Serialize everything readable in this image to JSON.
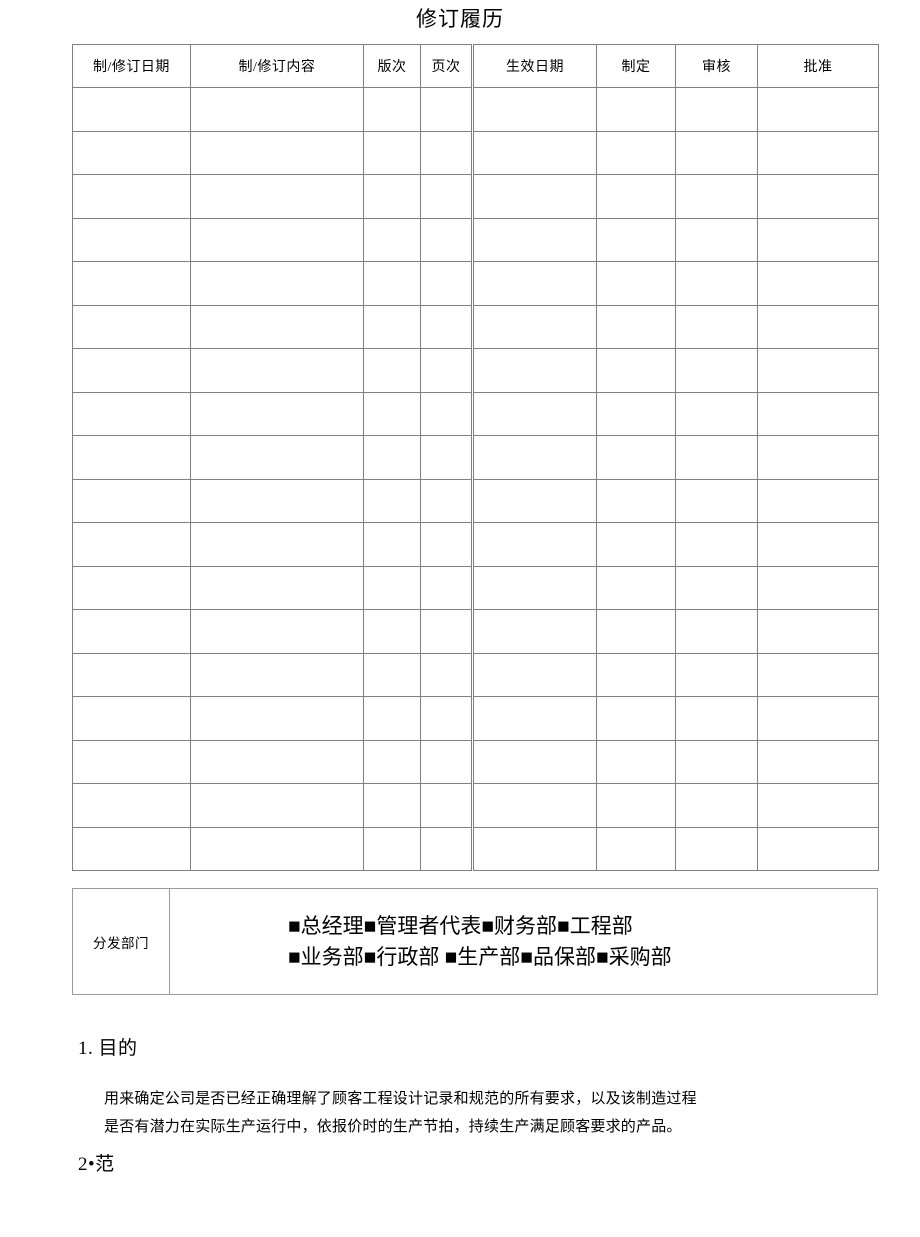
{
  "document": {
    "title": "修订履历"
  },
  "revision_table": {
    "headers": [
      "制/修订日期",
      "制/修订内容",
      "版次",
      "页次",
      "生效日期",
      "制定",
      "审核",
      "批准"
    ],
    "row_count": 18,
    "rows": [
      [
        "",
        "",
        "",
        "",
        "",
        "",
        "",
        ""
      ],
      [
        "",
        "",
        "",
        "",
        "",
        "",
        "",
        ""
      ],
      [
        "",
        "",
        "",
        "",
        "",
        "",
        "",
        ""
      ],
      [
        "",
        "",
        "",
        "",
        "",
        "",
        "",
        ""
      ],
      [
        "",
        "",
        "",
        "",
        "",
        "",
        "",
        ""
      ],
      [
        "",
        "",
        "",
        "",
        "",
        "",
        "",
        ""
      ],
      [
        "",
        "",
        "",
        "",
        "",
        "",
        "",
        ""
      ],
      [
        "",
        "",
        "",
        "",
        "",
        "",
        "",
        ""
      ],
      [
        "",
        "",
        "",
        "",
        "",
        "",
        "",
        ""
      ],
      [
        "",
        "",
        "",
        "",
        "",
        "",
        "",
        ""
      ],
      [
        "",
        "",
        "",
        "",
        "",
        "",
        "",
        ""
      ],
      [
        "",
        "",
        "",
        "",
        "",
        "",
        "",
        ""
      ],
      [
        "",
        "",
        "",
        "",
        "",
        "",
        "",
        ""
      ],
      [
        "",
        "",
        "",
        "",
        "",
        "",
        "",
        ""
      ],
      [
        "",
        "",
        "",
        "",
        "",
        "",
        "",
        ""
      ],
      [
        "",
        "",
        "",
        "",
        "",
        "",
        "",
        ""
      ],
      [
        "",
        "",
        "",
        "",
        "",
        "",
        "",
        ""
      ],
      [
        "",
        "",
        "",
        "",
        "",
        "",
        "",
        ""
      ]
    ]
  },
  "distribution": {
    "label": "分发部门",
    "line_1": "■总经理■管理者代表■财务部■工程部",
    "line_2": "■业务部■行政部 ■生产部■品保部■采购部",
    "departments": [
      "总经理",
      "管理者代表",
      "财务部",
      "工程部",
      "业务部",
      "行政部",
      "生产部",
      "品保部",
      "采购部"
    ],
    "checkbox_glyph": "■"
  },
  "sections": {
    "section_1": {
      "heading": "1. 目的",
      "line_1": "用来确定公司是否已经正确理解了顾客工程设计记录和规范的所有要求，以及该制造过程",
      "line_2": "是否有潜力在实际生产运行中，依报价时的生产节拍，持续生产满足顾客要求的产品。"
    },
    "section_2": {
      "heading": "2•范"
    }
  },
  "colors": {
    "text": "#000000",
    "page_background": "#ffffff",
    "table_border": "#808080",
    "box_border": "#9a9a9a"
  }
}
